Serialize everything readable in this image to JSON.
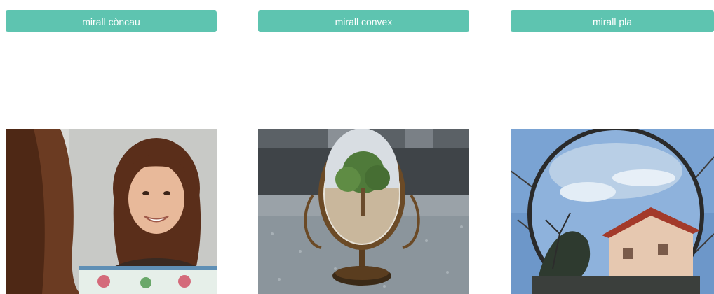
{
  "tabs": [
    {
      "label": "mirall còncau"
    },
    {
      "label": "mirall convex"
    },
    {
      "label": "mirall pla"
    }
  ],
  "images": [
    {
      "subject": "woman-smiling-in-concave-mirror"
    },
    {
      "subject": "table-mirror-on-stand-reflecting-tree"
    },
    {
      "subject": "round-convex-traffic-mirror-reflecting-house"
    }
  ]
}
